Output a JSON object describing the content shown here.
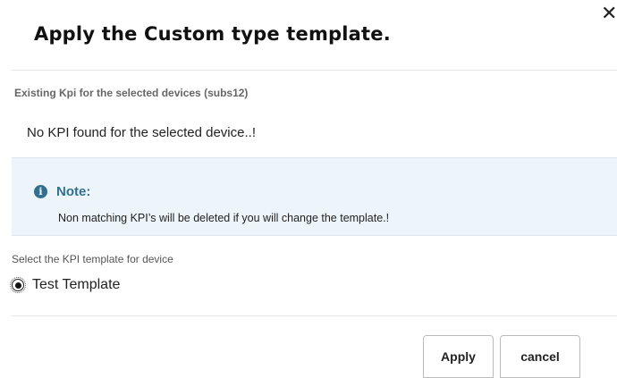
{
  "dialog": {
    "title": "Apply the Custom type template.",
    "close_glyph": "✕"
  },
  "existing": {
    "label": "Existing Kpi for the selected devices (subs12)",
    "empty_message": "No KPI found for the selected device..!"
  },
  "note": {
    "icon": "info-circle-icon",
    "icon_glyph": "i",
    "title": "Note:",
    "text": "Non matching KPI’s will be deleted if you will change the template.!",
    "accent_color": "#31708f",
    "background_color": "#eef5fa"
  },
  "template_select": {
    "label": "Select the KPI template for device",
    "options": [
      {
        "label": "Test Template",
        "selected": true
      }
    ]
  },
  "footer": {
    "apply_label": "Apply",
    "cancel_label": "cancel"
  }
}
